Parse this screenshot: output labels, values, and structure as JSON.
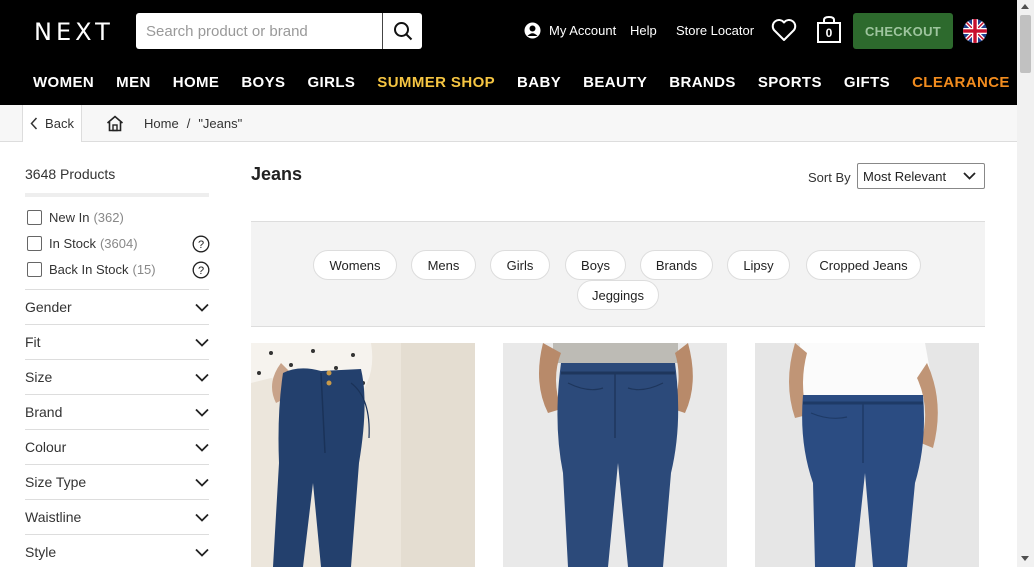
{
  "brand": {
    "logo": "NEXT"
  },
  "search": {
    "placeholder": "Search product or brand"
  },
  "header": {
    "account": "My Account",
    "help": "Help",
    "store_locator": "Store Locator",
    "bag_count": "0",
    "checkout": "CHECKOUT"
  },
  "nav": [
    "WOMEN",
    "MEN",
    "HOME",
    "BOYS",
    "GIRLS",
    "SUMMER SHOP",
    "BABY",
    "BEAUTY",
    "BRANDS",
    "SPORTS",
    "GIFTS",
    "CLEARANCE"
  ],
  "nav_colors": {
    "summer_shop": "#f5c542",
    "clearance": "#f28c1e"
  },
  "breadcrumb": {
    "back": "Back",
    "home": "Home",
    "sep": "/",
    "current": "\"Jeans\""
  },
  "sidebar": {
    "product_count": "3648 Products",
    "checks": [
      {
        "label": "New In",
        "count": "(362)"
      },
      {
        "label": "In Stock",
        "count": "(3604)"
      },
      {
        "label": "Back In Stock",
        "count": "(15)"
      }
    ],
    "filters": [
      "Gender",
      "Fit",
      "Size",
      "Brand",
      "Colour",
      "Size Type",
      "Waistline",
      "Style"
    ]
  },
  "main": {
    "title": "Jeans",
    "sort_label": "Sort By",
    "sort_value": "Most Relevant",
    "chips": [
      "Womens",
      "Mens",
      "Girls",
      "Boys",
      "Brands",
      "Lipsy",
      "Cropped Jeans",
      "Jeggings"
    ]
  },
  "colors": {
    "header_bg": "#000000",
    "checkout_bg": "#2d6a2d",
    "denim": "#2c4a7a"
  }
}
